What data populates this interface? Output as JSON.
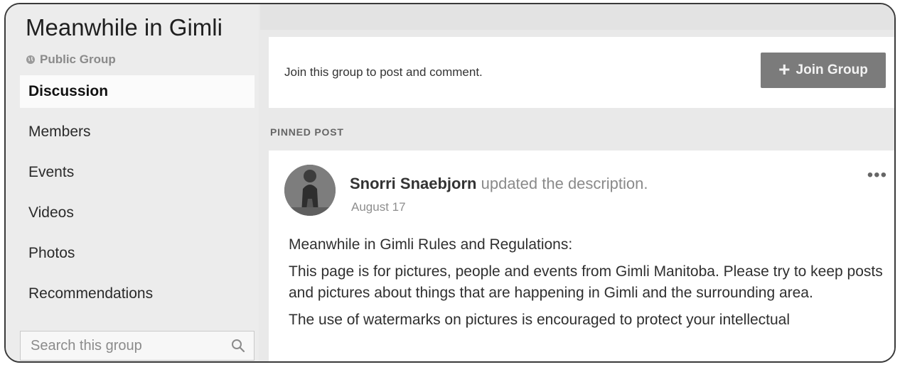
{
  "group": {
    "title": "Meanwhile in Gimli",
    "privacy": "Public Group"
  },
  "nav": {
    "items": [
      {
        "label": "Discussion",
        "active": true
      },
      {
        "label": "Members"
      },
      {
        "label": "Events"
      },
      {
        "label": "Videos"
      },
      {
        "label": "Photos"
      },
      {
        "label": "Recommendations"
      }
    ]
  },
  "search": {
    "placeholder": "Search this group",
    "icon": "search-icon"
  },
  "join_card": {
    "prompt": "Join this group to post and comment.",
    "button_label": "Join Group",
    "button_icon": "plus-icon"
  },
  "pinned": {
    "label": "PINNED POST"
  },
  "post": {
    "author": "Snorri Snaebjorn",
    "action": "updated the description.",
    "date": "August 17",
    "more_icon": "more-options-icon",
    "paragraphs": [
      "Meanwhile in Gimli Rules and Regulations:",
      "This page is for pictures, people and events from Gimli Manitoba. Please try to keep posts and pictures about things that are happening in Gimli and the surrounding area.",
      "The use of watermarks on pictures is encouraged to protect your intellectual"
    ]
  },
  "colors": {
    "join_button": "#7b7b7b",
    "sidebar_bg": "#ececec",
    "page_bg": "#e9e9e9"
  }
}
